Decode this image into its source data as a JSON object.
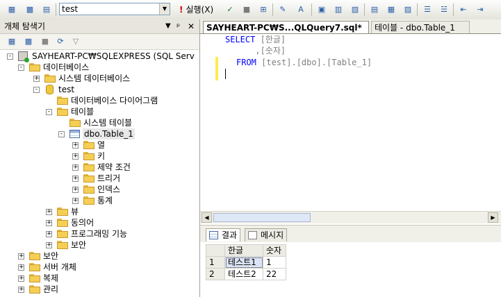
{
  "toolbar": {
    "database_value": "test",
    "execute_label": "실행(X)",
    "accent": "#2a5ea8"
  },
  "object_explorer": {
    "title": "개체 탐색기",
    "pin_glyph": "▾ ᵖ ✕",
    "tree": [
      {
        "label": "SAYHEART-PC₩SQLEXPRESS (SQL Serv",
        "expander": "-"
      },
      {
        "label": "데이터베이스",
        "expander": "-"
      },
      {
        "label": "시스템 데이터베이스",
        "expander": "+"
      },
      {
        "label": "test",
        "expander": "-"
      },
      {
        "label": "데이터베이스 다이어그램",
        "expander": ""
      },
      {
        "label": "테이블",
        "expander": "-"
      },
      {
        "label": "시스템 테이블",
        "expander": ""
      },
      {
        "label": "dbo.Table_1",
        "expander": "-"
      },
      {
        "label": "열",
        "expander": "+"
      },
      {
        "label": "키",
        "expander": "+"
      },
      {
        "label": "제약 조건",
        "expander": "+"
      },
      {
        "label": "트리거",
        "expander": "+"
      },
      {
        "label": "인덱스",
        "expander": "+"
      },
      {
        "label": "통계",
        "expander": "+"
      },
      {
        "label": "뷰",
        "expander": "+"
      },
      {
        "label": "동의어",
        "expander": "+"
      },
      {
        "label": "프로그래밍 기능",
        "expander": "+"
      },
      {
        "label": "보안",
        "expander": "+"
      },
      {
        "label": "보안",
        "expander": "+"
      },
      {
        "label": "서버 개체",
        "expander": "+"
      },
      {
        "label": "복제",
        "expander": "+"
      },
      {
        "label": "관리",
        "expander": "+"
      }
    ]
  },
  "editor": {
    "tab_active": "SAYHEART-PC₩S...QLQuery7.sql*",
    "tab_inactive": "테이블 - dbo.Table_1",
    "code": {
      "l1_kw": "SELECT",
      "l1_rest": " [한글]",
      "l2": "      ,[숫자]",
      "l3_kw": "FROM",
      "l3_rest": " [test].[dbo].[Table_1]"
    }
  },
  "results": {
    "tab_results": "결과",
    "tab_messages": "메시지",
    "columns": [
      "한글",
      "숫자"
    ],
    "rows": [
      {
        "num": "1",
        "col1": "테스트1",
        "col2": "1"
      },
      {
        "num": "2",
        "col1": "테스트2",
        "col2": "22"
      }
    ]
  }
}
